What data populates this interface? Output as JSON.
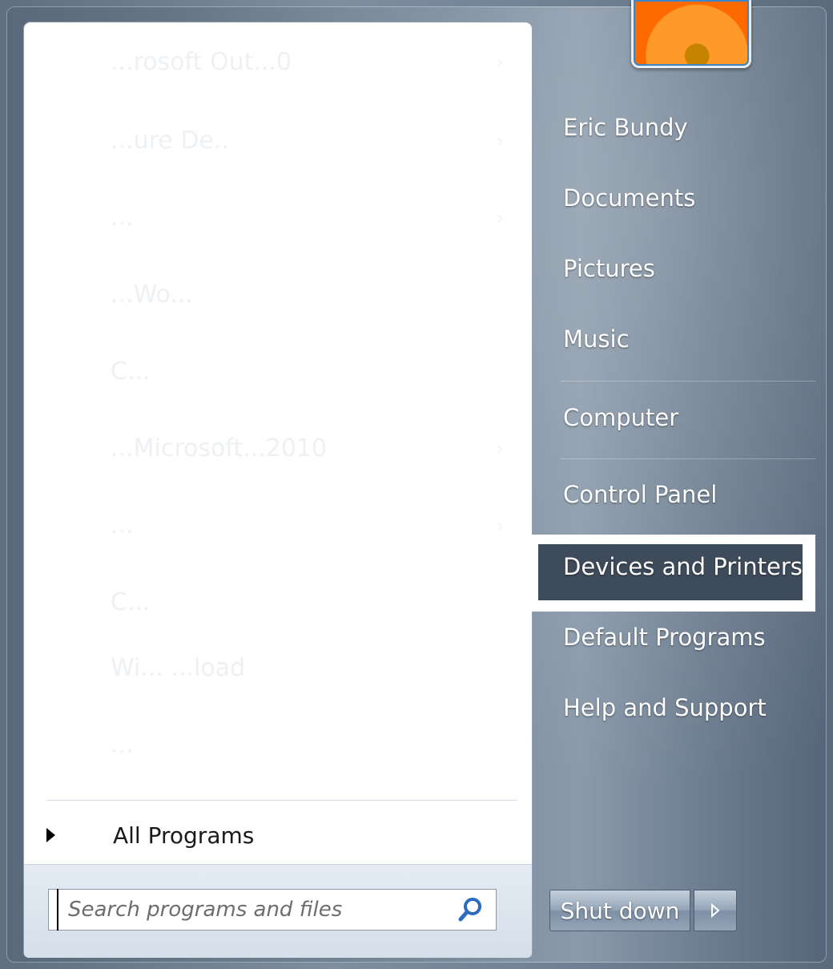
{
  "user": {
    "name": "Eric Bundy"
  },
  "left_pane": {
    "faded_items": [
      {
        "label": "...rosoft Out...0",
        "has_arrow": true
      },
      {
        "label": "...ure De..",
        "has_arrow": true
      },
      {
        "label": "...",
        "has_arrow": true
      },
      {
        "label": "...Wo...",
        "has_arrow": false
      },
      {
        "label": "C...",
        "has_arrow": false
      },
      {
        "label": "...Microsoft...2010",
        "has_arrow": true
      },
      {
        "label": "...",
        "has_arrow": true
      },
      {
        "label": "C...",
        "has_arrow": false
      },
      {
        "label": "Wi... ...load",
        "has_arrow": false
      },
      {
        "label": "...",
        "has_arrow": false
      }
    ],
    "all_programs_label": "All Programs",
    "search": {
      "placeholder": "Search programs and files",
      "icon": "search-icon"
    }
  },
  "right_pane": {
    "items": [
      {
        "label": "Eric Bundy"
      },
      {
        "label": "Documents"
      },
      {
        "label": "Pictures"
      },
      {
        "label": "Music"
      },
      {
        "label": "Computer"
      },
      {
        "label": "Control Panel"
      },
      {
        "label": "Devices and Printers",
        "highlighted": true
      },
      {
        "label": "Default Programs"
      },
      {
        "label": "Help and Support"
      }
    ],
    "shutdown_label": "Shut down"
  },
  "colors": {
    "highlight": "#3e4b5b",
    "frame": "#ffffff"
  }
}
